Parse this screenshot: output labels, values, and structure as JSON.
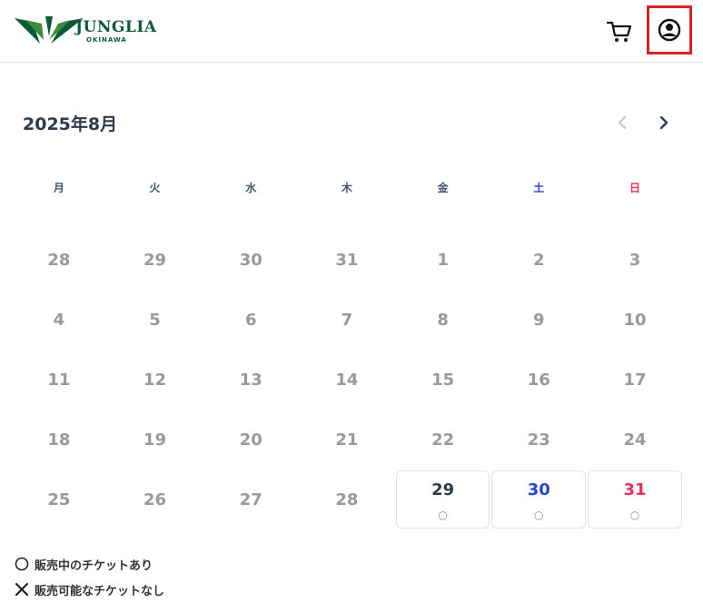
{
  "header": {
    "logo_text": "JUNGLIA",
    "logo_subtext": "OKINAWA"
  },
  "calendar": {
    "month_title": "2025年8月",
    "weekdays": [
      "月",
      "火",
      "水",
      "木",
      "金",
      "土",
      "日"
    ],
    "weeks": [
      [
        "28",
        "29",
        "30",
        "31",
        "1",
        "2",
        "3"
      ],
      [
        "4",
        "5",
        "6",
        "7",
        "8",
        "9",
        "10"
      ],
      [
        "11",
        "12",
        "13",
        "14",
        "15",
        "16",
        "17"
      ],
      [
        "18",
        "19",
        "20",
        "21",
        "22",
        "23",
        "24"
      ],
      [
        "25",
        "26",
        "27",
        "28",
        "29",
        "30",
        "31"
      ]
    ],
    "available": {
      "day29": "29",
      "day30": "30",
      "day31": "31",
      "mark": "○"
    }
  },
  "legend": {
    "available_label": "販売中のチケットあり",
    "unavailable_label": "販売可能なチケットなし"
  },
  "colors": {
    "brand": "#0c5a37",
    "saturday": "#2246d8",
    "sunday": "#e8305a",
    "highlight_border": "#e02020"
  }
}
